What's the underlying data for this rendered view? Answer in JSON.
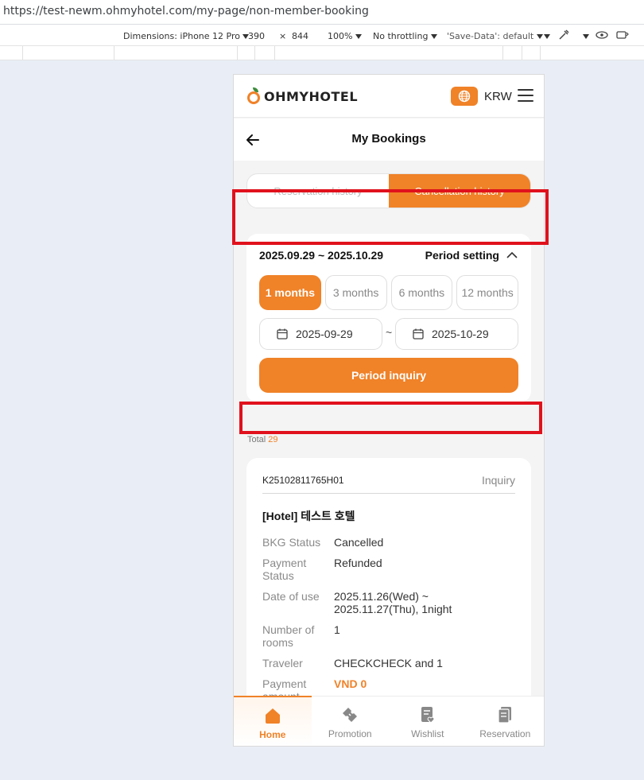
{
  "browser": {
    "url": "https://test-newm.ohmyhotel.com/my-page/non-member-booking",
    "devtools": {
      "dimensions_label": "Dimensions: iPhone 12 Pro",
      "width": "390",
      "times": "×",
      "height": "844",
      "zoom": "100%",
      "throttling": "No throttling",
      "save_data": "'Save-Data': default"
    }
  },
  "header": {
    "logo_text": "OHMYHOTEL",
    "currency": "KRW",
    "brand_color": "#f08228"
  },
  "titlebar": {
    "title": "My Bookings"
  },
  "tabs": {
    "reservation": "Reservation history",
    "cancellation": "Cancellation history"
  },
  "filter": {
    "period_range": "2025.09.29 ~ 2025.10.29",
    "period_setting": "Period setting",
    "months": [
      "1 months",
      "3 months",
      "6 months",
      "12 months"
    ],
    "date_from": "2025-09-29",
    "date_sep": "~",
    "date_to": "2025-10-29",
    "inquiry_label": "Period inquiry"
  },
  "total": {
    "label": "Total",
    "count": "29"
  },
  "booking": {
    "number": "K25102811765H01",
    "inquiry": "Inquiry",
    "hotel": "[Hotel] 테스트 호텔",
    "rows": [
      {
        "label": "BKG Status",
        "value": "Cancelled"
      },
      {
        "label": "Payment Status",
        "value": "Refunded"
      },
      {
        "label": "Date of use",
        "value": "2025.11.26(Wed) ~ 2025.11.27(Thu), 1night"
      },
      {
        "label": "Number of rooms",
        "value": "1"
      },
      {
        "label": "Traveler",
        "value": "CHECKCHECK and 1"
      },
      {
        "label": "Payment amount",
        "value": "VND 0"
      }
    ]
  },
  "nav": {
    "home": "Home",
    "promotion": "Promotion",
    "wishlist": "Wishlist",
    "reservation": "Reservation"
  },
  "annotation_color": "#e0111c"
}
